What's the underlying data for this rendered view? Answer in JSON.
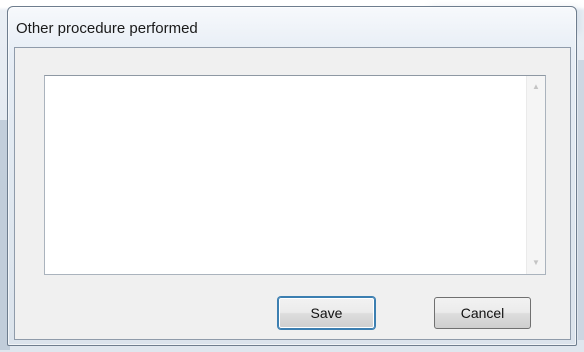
{
  "dialog": {
    "title": "Other procedure performed"
  },
  "textarea": {
    "value": ""
  },
  "buttons": {
    "save_label": "Save",
    "cancel_label": "Cancel"
  },
  "icons": {
    "scroll_up": "scroll-up-arrow-icon",
    "scroll_down": "scroll-down-arrow-icon"
  }
}
